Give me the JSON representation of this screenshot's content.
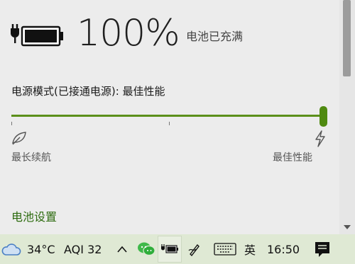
{
  "battery": {
    "percent_text": "100%",
    "status": "电池已充满"
  },
  "power_mode": {
    "title": "电源模式(已接通电源): 最佳性能",
    "slider_value": 1.0,
    "left_label": "最长续航",
    "right_label": "最佳性能"
  },
  "links": {
    "battery_settings": "电池设置"
  },
  "taskbar": {
    "temperature": "34°C",
    "aqi": "AQI 32",
    "ime": "英",
    "time": "16:50"
  },
  "colors": {
    "accent": "#4f8a10",
    "link": "#2d6b0f",
    "taskbar_bg": "#dfe9d4",
    "panel_bg": "#ececec"
  }
}
